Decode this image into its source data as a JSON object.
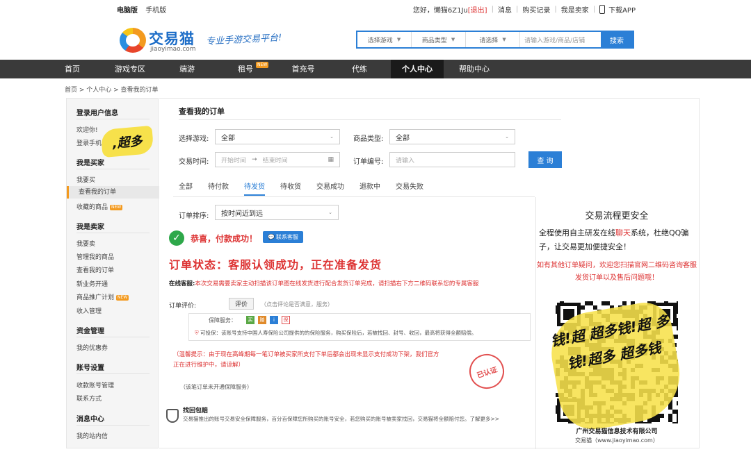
{
  "topbar": {
    "pc": "电脑版",
    "mobile": "手机版",
    "greeting": "您好，懒猫6Z1Ju",
    "logout": "[退出]",
    "messages": "消息",
    "purchase_records": "购买记录",
    "i_am_seller": "我是卖家",
    "download_app": "下载APP"
  },
  "logo": {
    "name": "交易猫",
    "domain": "jiaoyimao.com",
    "slogan": "专业手游交易平台!"
  },
  "search": {
    "game_select": "选择游戏",
    "type_select": "商品类型",
    "choose_select": "请选择",
    "placeholder": "请输入游戏/商品/店铺",
    "button": "搜索"
  },
  "nav": {
    "items": [
      "首页",
      "游戏专区",
      "端游",
      "租号",
      "首充号",
      "代练",
      "个人中心",
      "帮助中心"
    ],
    "new_badge": "NEW"
  },
  "breadcrumb": "首页 > 个人中心 > 查看我的订单",
  "sidebar": {
    "login_info": "登录用户信息",
    "welcome": "欢迎你!",
    "login_phone": "登录手机",
    "sticker": ",超多",
    "buyer": "我是买家",
    "buyer_items": [
      "我要买",
      "查看我的订单",
      "收藏的商品"
    ],
    "seller": "我是卖家",
    "seller_items": [
      "我要卖",
      "管理我的商品",
      "查看我的订单",
      "新业务开通",
      "商品推广计划",
      "收入管理"
    ],
    "funds": "资金管理",
    "funds_items": [
      "我的优惠券"
    ],
    "account": "账号设置",
    "account_items": [
      "收款账号管理",
      "联系方式"
    ],
    "msg_center": "消息中心",
    "msg_items": [
      "我的站内信"
    ],
    "new_badge": "NEW"
  },
  "main": {
    "title": "查看我的订单",
    "filter": {
      "game_label": "选择游戏:",
      "game_value": "全部",
      "type_label": "商品类型:",
      "type_value": "全部",
      "time_label": "交易时间:",
      "start_ph": "开始时间",
      "arrow": "→",
      "end_ph": "结束时间",
      "order_label": "订单编号:",
      "order_ph": "请输入",
      "query": "查 询"
    },
    "tabs": [
      "全部",
      "待付款",
      "待发货",
      "待收货",
      "交易成功",
      "退款中",
      "交易失败"
    ],
    "sort_label": "订单排序:",
    "sort_value": "按时间近到远",
    "success": "恭喜，付款成功！",
    "cs_button": "联系客服",
    "status": "订单状态：客服认领成功，正在准备发货",
    "online_label": "在线客服:",
    "online_text": "本次交易需要卖家主动扫描该订单图在线发货进行配合发货订单完成，请扫描右下方二维码联系您的专属客服",
    "rate_label": "订单评价:",
    "rate_button": "评价",
    "rate_tip": "（点击评论是否满意，服务）",
    "guarantee_label": "保障服务：",
    "guarantee_icons": [
      "买",
      "赔",
      "i",
      "保"
    ],
    "guarantee_text": "可投保：该账号支持中国人寿保险公司提供的的保险服务，购买保险后，若被找回、封号、收回，最高将获得全额赔偿。",
    "warm_tip": "（温馨提示：由于现在高峰期每一笔订单被买家所支付下单后都会出现未显示支付成功下架，我们官方正在进行维护中，请谅解）",
    "stamp": "已认证",
    "no_guarantee": "（该笔订单未开通保障服务）",
    "retrieve_title": "找回包赔",
    "retrieve_text": "交易猫推出的账号交易安全保障服务，百分百保障您所购买的账号安全，若您购买的账号被卖家找回，交易猫将全额赔付您。了解更多>>"
  },
  "side_panel": {
    "title": "交易流程更安全",
    "desc_before": "全程使用自主研发在线",
    "desc_highlight": "聊天",
    "desc_after": "系统，杜绝QQ骗子，让交易更加便捷安全！",
    "red_text": "如有其他订单疑问，欢迎您扫描官网二维码咨询客服发货订单以及售后问题哦！",
    "sticker": "钱!超 超多钱!超 多钱!超多 超多钱",
    "company": "广州交易猫信息技术有限公司",
    "site": "交易猫（www.jiaoyimao.com）"
  }
}
